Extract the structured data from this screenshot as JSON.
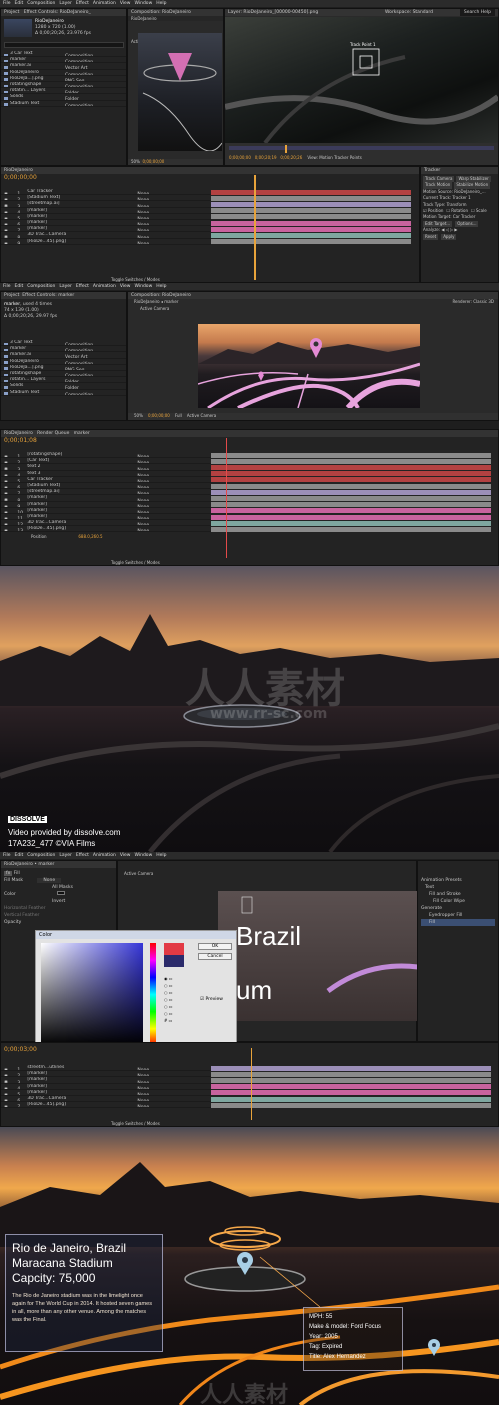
{
  "menu": [
    "File",
    "Edit",
    "Composition",
    "Layer",
    "Effect",
    "Animation",
    "View",
    "Window",
    "Help"
  ],
  "screen1": {
    "project_label": "Project",
    "effect_controls_label": "Effect Controls: RioDeJaneiro_",
    "comp_tab": "Composition: RioDeJaneiro",
    "layer_tab": "Layer: RioDeJaneiro_[00000-00450].png",
    "footage_name": "RioDeJaneiro",
    "footage_info": "1280 x 720 (1.00)",
    "footage_info2": "Δ 0;00;20;26, 23.976 fps",
    "project_items": [
      {
        "name": "3 Car Text",
        "type": "Composition"
      },
      {
        "name": "marker",
        "type": "Composition"
      },
      {
        "name": "marker.ai",
        "type": "Vector Art"
      },
      {
        "name": "RioDeJaneiro",
        "type": "Composition"
      },
      {
        "name": "RioDeJa...].png",
        "type": "PNG Seq..."
      },
      {
        "name": "rotatingshape",
        "type": "Composition"
      },
      {
        "name": "rotatin... Layers",
        "type": "Folder"
      },
      {
        "name": "Solids",
        "type": "Folder"
      },
      {
        "name": "Stadium Text",
        "type": "Composition"
      }
    ],
    "track_point": "Track Point 1",
    "snapping": "Snapping",
    "workspace": "Workspace:",
    "workspace_value": "Standard",
    "search_help": "Search Help",
    "renderer": "Renderer:",
    "renderer_value": "Classic 3D",
    "active_camera": "Active Camera",
    "view_label": "View:",
    "view_value": "Motion Tracker Points",
    "timecode_a": "0;00;00;00",
    "timecode_b": "0;00;20;19",
    "timecode_c": "0;00;20;26",
    "comp_tab2": "RioDeJaneiro",
    "layers": [
      {
        "num": "1",
        "name": "Car Tracker"
      },
      {
        "num": "2",
        "name": "[Stadium Text]"
      },
      {
        "num": "3",
        "name": "[streetmap.ai]"
      },
      {
        "num": "4",
        "name": "[marker]"
      },
      {
        "num": "5",
        "name": "[marker]"
      },
      {
        "num": "6",
        "name": "[marker]"
      },
      {
        "num": "7",
        "name": "[marker]"
      },
      {
        "num": "8",
        "name": "3D Trac...Camera"
      },
      {
        "num": "9",
        "name": "[RioDe...45].png]"
      }
    ],
    "parent_value": "None",
    "tracker_panel": {
      "title": "Tracker",
      "track_camera": "Track Camera",
      "warp_stabilizer": "Warp Stabilizer",
      "track_motion": "Track Motion",
      "stabilize_motion": "Stabilize Motion",
      "motion_source": "Motion Source:",
      "motion_source_value": "RioDeJaneiro_...",
      "current_track": "Current Track:",
      "current_track_value": "Tracker 1",
      "track_type": "Track Type:",
      "track_type_value": "Transform",
      "position": "Position",
      "rotation": "Rotation",
      "scale": "Scale",
      "motion_target": "Motion Target: Car Tracker",
      "edit_target": "Edit Target...",
      "options": "Options...",
      "analyze": "Analyze:",
      "reset": "Reset",
      "apply": "Apply"
    },
    "toggle": "Toggle Switches / Modes",
    "zoom": "50%",
    "quality": "Full"
  },
  "screen2": {
    "effect_controls_label": "Effect Controls: marker",
    "comp_tab": "Composition: RioDeJaneiro",
    "breadcrumb": [
      "RioDeJaneiro",
      "marker"
    ],
    "footage_name": "marker",
    "footage_used": ", used 4 times",
    "footage_info": "74 x 139 (1.00)",
    "footage_info2": "Δ 0;00;20;26, 29.97 fps",
    "project_items": [
      {
        "name": "3 Car Text",
        "type": "Composition"
      },
      {
        "name": "marker",
        "type": "Composition"
      },
      {
        "name": "marker.ai",
        "type": "Vector Art"
      },
      {
        "name": "RioDeJaneiro",
        "type": "Composition"
      },
      {
        "name": "RioDeJa...].png",
        "type": "PNG Seq..."
      },
      {
        "name": "rotatingshape",
        "type": "Composition"
      },
      {
        "name": "rotatin... Layers",
        "type": "Folder"
      },
      {
        "name": "Solids",
        "type": "Folder"
      },
      {
        "name": "Stadium Text",
        "type": "Composition"
      }
    ],
    "timeline_tabs": [
      "RioDeJaneiro",
      "Render Queue",
      "marker"
    ],
    "timecode": "0;00;01;08",
    "layers": [
      {
        "num": "1",
        "name": "[rotatingshape]"
      },
      {
        "num": "2",
        "name": "[Car Text]"
      },
      {
        "num": "3",
        "name": "text 2"
      },
      {
        "num": "4",
        "name": "text 3"
      },
      {
        "num": "5",
        "name": "Car Tracker"
      },
      {
        "num": "6",
        "name": "[Stadium Text]"
      },
      {
        "num": "7",
        "name": "[streetmap.ai]"
      },
      {
        "num": "8",
        "name": "[marker]"
      },
      {
        "num": "9",
        "name": "[marker]"
      },
      {
        "num": "10",
        "name": "[marker]"
      },
      {
        "num": "11",
        "name": "[marker]"
      },
      {
        "num": "12",
        "name": "3D Trac...Camera"
      },
      {
        "num": "13",
        "name": "[RioDe...45].png]"
      }
    ],
    "position_label": "Position",
    "position_value": "688.0,260.5",
    "toggle": "Toggle Switches / Modes"
  },
  "screen3": {
    "brand": "DISSOLVE",
    "credit1": "Video provided by dissolve.com",
    "credit2": "17A232_477 ©VIA Films"
  },
  "screen4": {
    "breadcrumb": "RioDeJaneiro • marker",
    "fill_label": "Fill",
    "fill_mask": "Fill Mask",
    "fill_mask_value": "None",
    "all_masks": "All Masks",
    "color_label": "Color",
    "invert": "Invert",
    "horizontal_feather": "Horizontal Feather",
    "vertical_feather": "Vertical Feather",
    "opacity": "Opacity",
    "dialog_title": "Color",
    "ok": "OK",
    "cancel": "Cancel",
    "preview": "Preview",
    "canvas_text1": "Brazil",
    "canvas_text2": "um",
    "effects_panel": {
      "title": "Effects & Presets",
      "animation_presets": "Animation Presets",
      "text": "Text",
      "fill_and_stroke": "Fill and Stroke",
      "fill_color_wipe": "Fill Color Wipe",
      "generate": "Generate",
      "eyedropper_fill": "Eyedropper Fill",
      "fill": "Fill"
    },
    "timecode": "0;00;03;00",
    "layers": [
      {
        "num": "1",
        "name": "streetm...utlines"
      },
      {
        "num": "2",
        "name": "[marker]"
      },
      {
        "num": "3",
        "name": "[marker]"
      },
      {
        "num": "4",
        "name": "[marker]"
      },
      {
        "num": "5",
        "name": "[marker]"
      },
      {
        "num": "6",
        "name": "3D Trac...Camera"
      },
      {
        "num": "7",
        "name": "[RioDe...45].png]"
      }
    ],
    "toggle": "Toggle Switches / Modes"
  },
  "screen5": {
    "box1": {
      "line1": "Rio de Janeiro, Brazil",
      "line2": "Maracana Stadium",
      "line3": "Capcity: 75,000",
      "para": "The Rio de Janeiro stadium was in the limelight once again for The World Cup in 2014. It hosted seven games in all, more than any other venue. Among the matches was the Final."
    },
    "box2": {
      "mph": "MPH: 55",
      "make": "Make & model: Ford Focus",
      "year": "Year: 2005",
      "tag": "Tag: Expired",
      "title": "Title: Alex Hernandez"
    }
  },
  "watermark": {
    "cn": "人人素材",
    "url": "www.rr-sc.com"
  },
  "colors": {
    "accent_orange": "#e8a33b",
    "bar_pink": "#c8639e",
    "bar_gray": "#8a8a8a",
    "bar_red": "#b34141",
    "bar_lavender": "#9c8fb8",
    "bar_teal": "#7fa7a0"
  }
}
